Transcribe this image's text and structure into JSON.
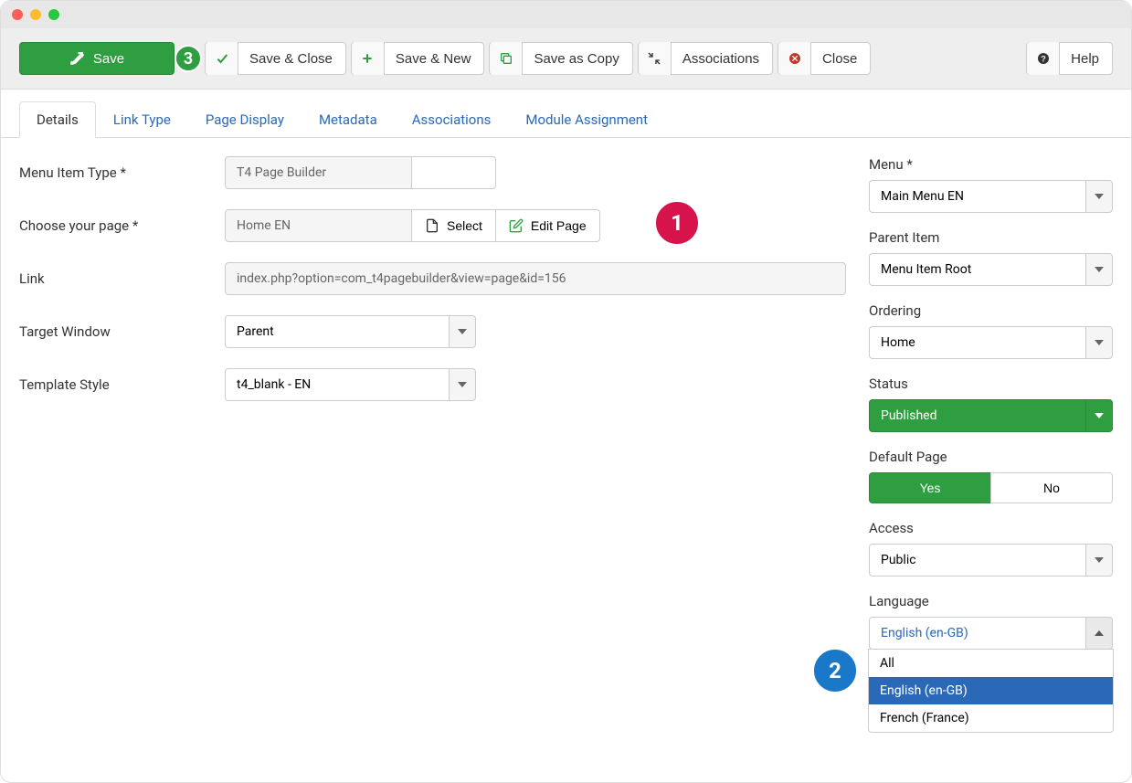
{
  "toolbar": {
    "save": "Save",
    "save_close": "Save & Close",
    "save_new": "Save & New",
    "save_copy": "Save as Copy",
    "associations": "Associations",
    "close": "Close",
    "help": "Help"
  },
  "badges": {
    "one": "1",
    "two": "2",
    "three": "3"
  },
  "tabs": {
    "details": "Details",
    "link_type": "Link Type",
    "page_display": "Page Display",
    "metadata": "Metadata",
    "associations": "Associations",
    "module_assignment": "Module Assignment"
  },
  "main": {
    "labels": {
      "menu_item_type": "Menu Item Type *",
      "choose_page": "Choose your page *",
      "link": "Link",
      "target_window": "Target Window",
      "template_style": "Template Style"
    },
    "values": {
      "menu_item_type": "T4 Page Builder",
      "select_btn": "Select",
      "choose_page": "Home EN",
      "select_page_btn": "Select",
      "edit_page_btn": "Edit Page",
      "link": "index.php?option=com_t4pagebuilder&view=page&id=156",
      "target_window": "Parent",
      "template_style": "t4_blank - EN"
    }
  },
  "side": {
    "menu": {
      "label": "Menu *",
      "value": "Main Menu EN"
    },
    "parent": {
      "label": "Parent Item",
      "value": "Menu Item Root"
    },
    "ordering": {
      "label": "Ordering",
      "value": "Home"
    },
    "status": {
      "label": "Status",
      "value": "Published"
    },
    "default_page": {
      "label": "Default Page",
      "yes": "Yes",
      "no": "No"
    },
    "access": {
      "label": "Access",
      "value": "Public"
    },
    "language": {
      "label": "Language",
      "value": "English (en-GB)",
      "options": {
        "all": "All",
        "en": "English (en-GB)",
        "fr": "French (France)"
      }
    }
  }
}
